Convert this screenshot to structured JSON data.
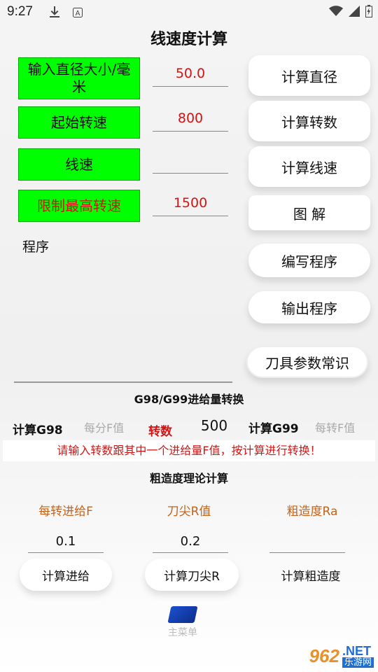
{
  "status": {
    "time": "9:27",
    "download_icon": "download-icon",
    "a_icon": "A",
    "wifi_icon": "wifi-icon",
    "signal_icon": "signal-icon",
    "battery_icon": "battery-icon"
  },
  "title": "线速度计算",
  "inputs": {
    "diameter_label": "输入直径大小/毫米",
    "diameter_value": "50.0",
    "start_speed_label": "起始转速",
    "start_speed_value": "800",
    "line_speed_label": "线速",
    "line_speed_value": "",
    "max_speed_label": "限制最高转速",
    "max_speed_value": "1500"
  },
  "buttons": {
    "calc_diameter": "计算直径",
    "calc_rpm": "计算转数",
    "calc_line_speed": "计算线速",
    "diagram": "图 解",
    "write_program": "编写程序",
    "output_program": "输出程序",
    "tool_params": "刀具参数常识"
  },
  "program_label": "程序",
  "g98": {
    "section_title": "G98/G99进给量转换",
    "calc_g98": "计算G98",
    "per_min_hint": "每分F值",
    "rpm_label": "转数",
    "rpm_value": "500",
    "calc_g99": "计算G99",
    "per_rev_hint": "每转F值",
    "warning": "请输入转数跟其中一个进给量F值，按计算进行转换！"
  },
  "roughness": {
    "section_title": "粗造度理论计算",
    "feed_label": "每转进给F",
    "feed_value": "0.1",
    "tip_r_label": "刀尖R值",
    "tip_r_value": "0.2",
    "ra_label": "粗造度Ra",
    "ra_value": "",
    "calc_feed": "计算进给",
    "calc_tip_r": "计算刀尖R",
    "calc_ra": "计算粗造度"
  },
  "main_menu": "主菜单",
  "watermark": {
    "number": "962",
    "net": ".NET",
    "site": "乐游网"
  }
}
